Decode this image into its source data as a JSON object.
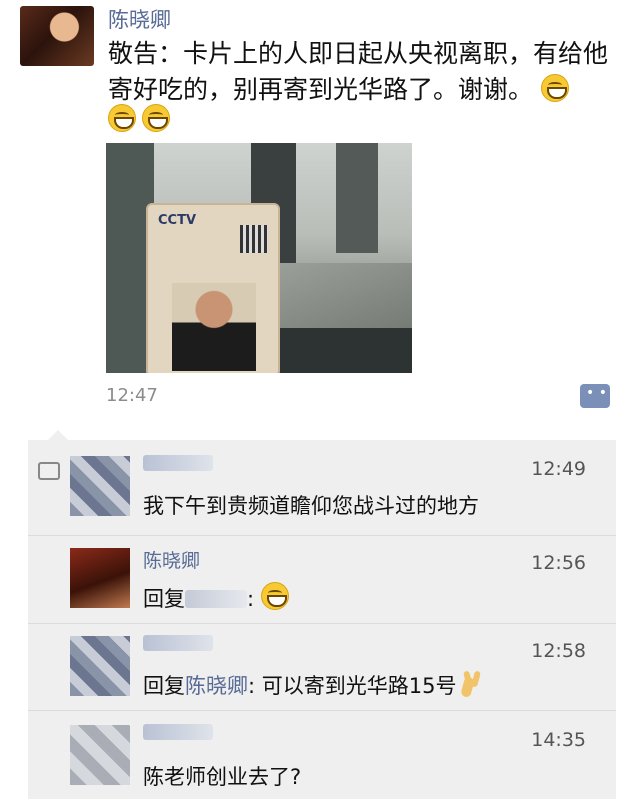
{
  "post": {
    "author": "陈晓卿",
    "text": "敬告：卡片上的人即日起从央视离职，有给他寄好吃的，别再寄到光华路了。谢谢。",
    "time": "12:47",
    "badge_logo": "CCTV",
    "icons": [
      "grinning-emoji",
      "grinning-emoji",
      "grinning-emoji"
    ]
  },
  "comments": [
    {
      "name": "",
      "time": "12:49",
      "text": "我下午到贵频道瞻仰您战斗过的地方"
    },
    {
      "name": "陈晓卿",
      "time": "12:56",
      "prefix": "回复",
      "suffix": ":"
    },
    {
      "name": "",
      "time": "12:58",
      "prefix": "回复",
      "mention": "陈晓卿",
      "suffix": ": 可以寄到光华路15号"
    },
    {
      "name": "",
      "time": "14:35",
      "text": "陈老师创业去了?"
    }
  ]
}
